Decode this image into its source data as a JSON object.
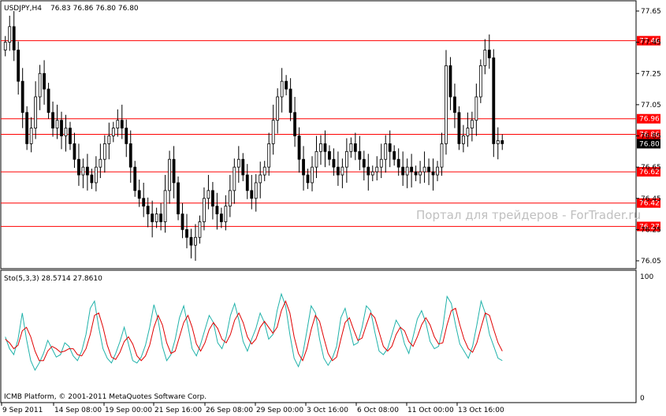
{
  "header": {
    "symbol": "USDJPY,H4",
    "ohlc": "76.83 76.86 76.80 76.80"
  },
  "indicator": {
    "label": "Sto(5,3,3) 28.5714 27.8610",
    "scale_top": "100",
    "scale_bottom": "0"
  },
  "watermark": "Портал для трейдеров - ForTrader.ru",
  "copyright": "ICMB Platform, © 2001-2011 MetaQuotes Software Corp.",
  "colors": {
    "level_line": "#ff0000",
    "candle": "#000000",
    "stoch_main": "#20b2aa",
    "stoch_signal": "#e00000",
    "watermark": "#c0c0c0"
  },
  "chart_data": {
    "type": "candlestick",
    "price_range": [
      75.95,
      77.55
    ],
    "price_ticks": [
      "77.65",
      "77.45",
      "77.25",
      "77.05",
      "76.85",
      "76.65",
      "76.45",
      "76.25",
      "76.05"
    ],
    "levels": [
      {
        "label": "77.46",
        "value": 77.46
      },
      {
        "label": "76.96",
        "value": 76.96
      },
      {
        "label": "76.86",
        "value": 76.86
      },
      {
        "label": "76.62",
        "value": 76.62
      },
      {
        "label": "76.42",
        "value": 76.42
      },
      {
        "label": "76.27",
        "value": 76.27
      }
    ],
    "current_price": {
      "label": "76.80",
      "value": 76.8
    },
    "time_labels": [
      "9 Sep 2011",
      "14 Sep 08:00",
      "19 Sep 00:00",
      "21 Sep 16:00",
      "26 Sep 08:00",
      "29 Sep 00:00",
      "3 Oct 16:00",
      "6 Oct 08:00",
      "11 Oct 00:00",
      "13 Oct 16:00"
    ],
    "closes": [
      77.45,
      77.55,
      77.4,
      77.2,
      77.0,
      76.8,
      76.9,
      77.1,
      77.25,
      77.15,
      77.0,
      76.9,
      76.95,
      76.85,
      76.9,
      76.8,
      76.7,
      76.6,
      76.65,
      76.6,
      76.55,
      76.65,
      76.7,
      76.8,
      76.85,
      76.9,
      76.95,
      76.9,
      76.8,
      76.65,
      76.5,
      76.45,
      76.4,
      76.35,
      76.3,
      76.35,
      76.3,
      76.5,
      76.7,
      76.55,
      76.35,
      76.25,
      76.2,
      76.15,
      76.2,
      76.3,
      76.45,
      76.5,
      76.4,
      76.35,
      76.3,
      76.4,
      76.5,
      76.65,
      76.7,
      76.6,
      76.5,
      76.45,
      76.55,
      76.6,
      76.65,
      76.8,
      76.95,
      77.1,
      77.2,
      77.15,
      77.0,
      76.85,
      76.7,
      76.6,
      76.55,
      76.65,
      76.75,
      76.8,
      76.75,
      76.7,
      76.65,
      76.6,
      76.65,
      76.75,
      76.8,
      76.75,
      76.7,
      76.65,
      76.6,
      76.62,
      76.65,
      76.7,
      76.8,
      76.75,
      76.7,
      76.65,
      76.6,
      76.65,
      76.62,
      76.6,
      76.62,
      76.65,
      76.62,
      76.6,
      76.65,
      76.8,
      77.3,
      77.1,
      77.0,
      76.8,
      76.85,
      76.9,
      76.95,
      77.1,
      77.3,
      77.4,
      77.35,
      76.8,
      76.82,
      76.8
    ]
  },
  "stochastic": {
    "main": [
      50,
      40,
      35,
      48,
      70,
      48,
      30,
      22,
      28,
      36,
      47,
      40,
      33,
      35,
      45,
      42,
      34,
      30,
      38,
      52,
      74,
      80,
      58,
      40,
      32,
      28,
      36,
      46,
      58,
      44,
      30,
      28,
      33,
      43,
      58,
      77,
      64,
      42,
      30,
      35,
      48,
      66,
      76,
      59,
      40,
      34,
      44,
      56,
      68,
      62,
      45,
      40,
      50,
      68,
      78,
      64,
      46,
      38,
      48,
      57,
      70,
      62,
      48,
      52,
      72,
      86,
      76,
      52,
      32,
      25,
      35,
      55,
      76,
      70,
      48,
      32,
      26,
      32,
      42,
      66,
      74,
      58,
      43,
      45,
      58,
      76,
      72,
      54,
      38,
      35,
      40,
      52,
      64,
      58,
      44,
      36,
      50,
      65,
      72,
      62,
      46,
      40,
      42,
      58,
      84,
      78,
      60,
      44,
      38,
      32,
      42,
      60,
      80,
      70,
      52,
      42,
      32,
      30
    ],
    "signal": [
      48,
      45,
      40,
      43,
      55,
      58,
      50,
      38,
      30,
      30,
      38,
      42,
      40,
      37,
      38,
      40,
      40,
      35,
      34,
      40,
      52,
      68,
      70,
      58,
      43,
      33,
      31,
      37,
      46,
      50,
      44,
      34,
      30,
      34,
      43,
      58,
      68,
      60,
      45,
      36,
      38,
      50,
      62,
      68,
      58,
      44,
      38,
      45,
      56,
      62,
      57,
      48,
      45,
      52,
      64,
      70,
      62,
      50,
      44,
      48,
      58,
      63,
      58,
      53,
      58,
      72,
      80,
      70,
      50,
      36,
      30,
      40,
      56,
      68,
      63,
      49,
      36,
      30,
      33,
      48,
      62,
      66,
      56,
      47,
      49,
      60,
      70,
      66,
      54,
      42,
      38,
      42,
      52,
      58,
      55,
      46,
      42,
      50,
      60,
      66,
      60,
      50,
      44,
      45,
      60,
      72,
      74,
      60,
      48,
      40,
      37,
      45,
      58,
      70,
      68,
      56,
      45,
      38
    ]
  }
}
